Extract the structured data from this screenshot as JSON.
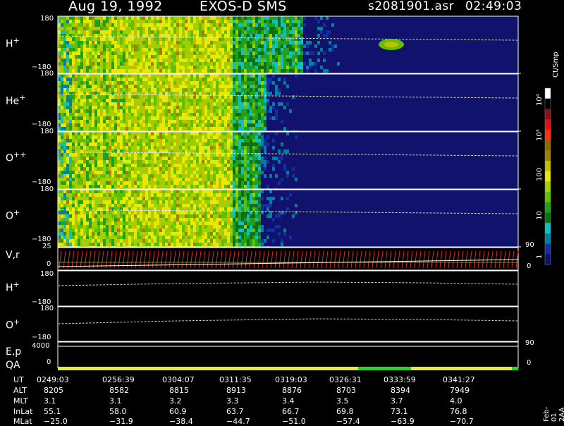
{
  "header": {
    "date": "Aug 19, 1992",
    "mission": "EXOS-D SMS",
    "file": "s2081901.asr",
    "time": "02:49:03"
  },
  "panels": [
    {
      "label": "H",
      "sup": "+",
      "ymax": "180",
      "ymin": "−180"
    },
    {
      "label": "He",
      "sup": "+",
      "ymax": "180",
      "ymin": "−180"
    },
    {
      "label": "O",
      "sup": "++",
      "ymax": "180",
      "ymin": "−180"
    },
    {
      "label": "O",
      "sup": "+",
      "ymax": "180",
      "ymin": "−180"
    }
  ],
  "line_panels": {
    "vr": {
      "label": "V,r",
      "ymax": "25",
      "ymid": "0",
      "right_top": "90",
      "right_bottom": "0"
    },
    "h": {
      "label": "H",
      "sup": "+",
      "ymax": "180",
      "ymin": "−180"
    },
    "o": {
      "label": "O",
      "sup": "+",
      "ymax": "180",
      "ymin": "−180"
    },
    "ep": {
      "label1": "E,p",
      "label2": "QA",
      "ymax": "4000",
      "ymin": "0",
      "right_mid": "90",
      "right_bottom": "0"
    }
  },
  "colorbar": {
    "unit": "Ct/Smp",
    "ticks": [
      "10⁴",
      "10³",
      "100",
      "10",
      "1"
    ],
    "colors": [
      "#ffffff",
      "#000000",
      "#8b1010",
      "#e01010",
      "#ff3010",
      "#8b6a00",
      "#a08000",
      "#c0c000",
      "#e8e800",
      "#a0d000",
      "#60c000",
      "#20a020",
      "#107010",
      "#10c0c0",
      "#0080a0",
      "#1030a0",
      "#101070"
    ]
  },
  "footer": {
    "headers": [
      "UT",
      "ALT",
      "MLT",
      "InLat",
      "MLat"
    ],
    "ut": [
      "0249:03",
      "0256:39",
      "0304:07",
      "0311:35",
      "0319:03",
      "0326:31",
      "0333:59",
      "0341:27"
    ],
    "alt": [
      "8205",
      "8582",
      "8815",
      "8913",
      "8876",
      "8703",
      "8394",
      "7949"
    ],
    "mlt": [
      "3.1",
      "3.1",
      "3.2",
      "3.3",
      "3.4",
      "3.5",
      "3.7",
      "4.0"
    ],
    "inlat": [
      "55.1",
      "58.0",
      "60.9",
      "63.7",
      "66.7",
      "69.8",
      "73.1",
      "76.8"
    ],
    "mlat": [
      "−25.0",
      "−31.9",
      "−38.4",
      "−44.7",
      "−51.0",
      "−57.4",
      "−63.9",
      "−70.7"
    ],
    "side_note": "Feb-01 2AA"
  },
  "chart_data": {
    "type": "heatmap",
    "title": "Aug 19, 1992   EXOS-D SMS",
    "x_ticks": [
      "0249:03",
      "0256:39",
      "0304:07",
      "0311:35",
      "0319:03",
      "0326:31",
      "0333:59",
      "0341:27"
    ],
    "series": [
      {
        "name": "H+",
        "ylim": [
          -180,
          180
        ]
      },
      {
        "name": "He+",
        "ylim": [
          -180,
          180
        ]
      },
      {
        "name": "O++",
        "ylim": [
          -180,
          180
        ]
      },
      {
        "name": "O+",
        "ylim": [
          -180,
          180
        ]
      }
    ],
    "color_scale": "log",
    "color_range": [
      1,
      10000
    ],
    "legend": "right"
  }
}
